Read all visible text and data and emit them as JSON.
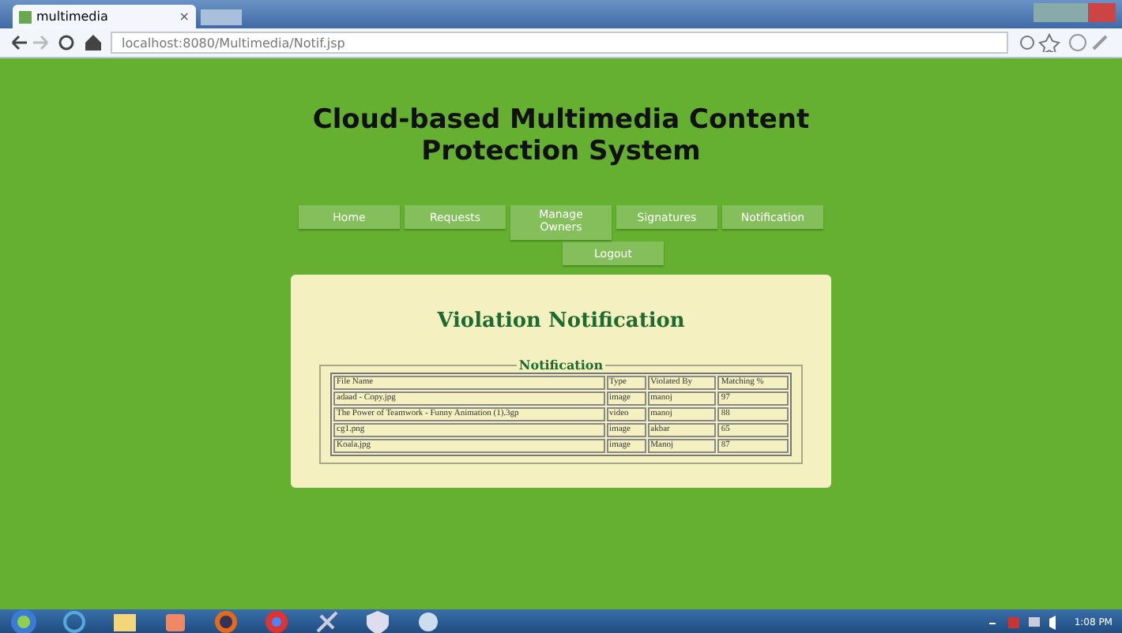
{
  "browser": {
    "tab_title": "multimedia",
    "close": "×",
    "url": "localhost:8080/Multimedia/Notif.jsp"
  },
  "site_title": "Cloud-based Multimedia Content Protection System",
  "nav": [
    {
      "label": "Home"
    },
    {
      "label": "Requests"
    },
    {
      "label": "Manage Owners"
    },
    {
      "label": "Signatures"
    },
    {
      "label": "Notification"
    },
    {
      "label": "Logout"
    }
  ],
  "heading": "Violation Notification",
  "notification": {
    "legend": "Notification",
    "columns": [
      "File Name",
      "Type",
      "Violated By",
      "Matching %"
    ],
    "rows": [
      [
        "adaad - Copy.jpg",
        "image",
        "manoj",
        "97"
      ],
      [
        "The Power of Teamwork - Funny Animation (1).3gp",
        "video",
        "manoj",
        "88"
      ],
      [
        "cg1.png",
        "image",
        "akbar",
        "65"
      ],
      [
        "Koala.jpg",
        "image",
        "Manoj",
        "87"
      ]
    ]
  },
  "taskbar": {
    "clock": "1:08 PM"
  }
}
